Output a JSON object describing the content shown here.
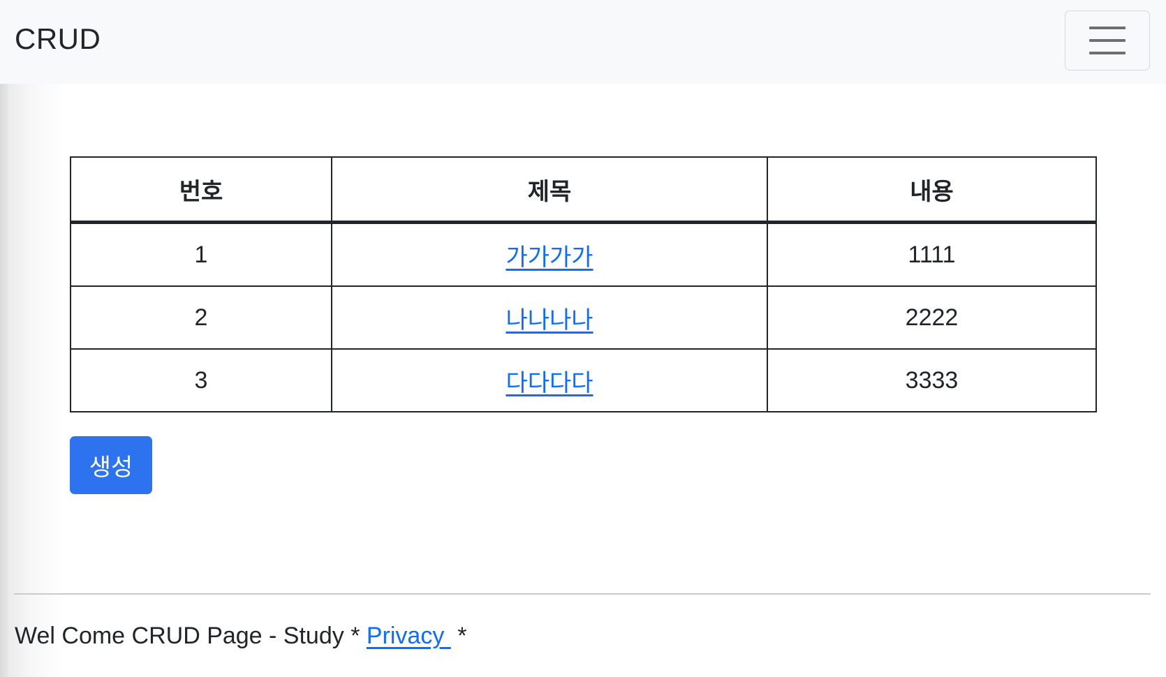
{
  "navbar": {
    "brand": "CRUD",
    "toggle_icon": "hamburger-menu-icon"
  },
  "table": {
    "headers": [
      "번호",
      "제목",
      "내용"
    ],
    "rows": [
      {
        "no": "1",
        "title": "가가가가",
        "content": "1111"
      },
      {
        "no": "2",
        "title": "나나나나",
        "content": "2222"
      },
      {
        "no": "3",
        "title": "다다다다",
        "content": "3333"
      }
    ]
  },
  "actions": {
    "create_label": "생성"
  },
  "footer": {
    "prefix": "Wel Come CRUD Page - Study * ",
    "link": "Privacy ",
    "suffix": " *"
  },
  "colors": {
    "link": "#0d6efd",
    "primary_button": "#2d73f0",
    "navbar_bg": "#f8f9fa"
  }
}
